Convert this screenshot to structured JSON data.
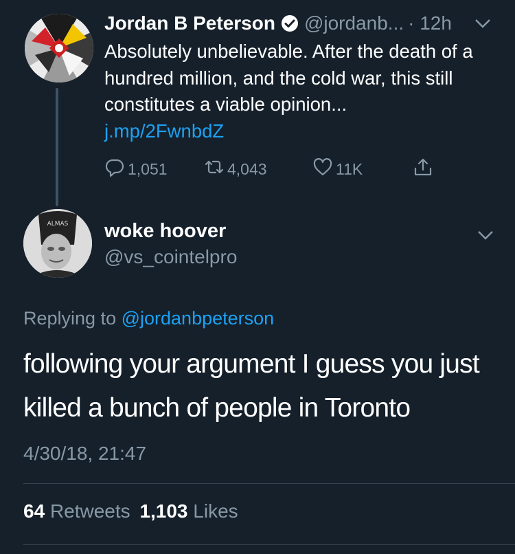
{
  "parent_tweet": {
    "display_name": "Jordan B Peterson",
    "handle": "@jordanb...",
    "time": "· 12h",
    "text": "Absolutely unbelievable. After the death of a hundred million, and the cold war, this still constitutes a viable opinion...",
    "link": "j.mp/2FwnbdZ",
    "reply_count": "1,051",
    "retweet_count": "4,043",
    "like_count": "11K",
    "icons": [
      "verified-icon",
      "chevron-down-icon",
      "reply-icon",
      "retweet-icon",
      "like-icon",
      "share-icon"
    ]
  },
  "reply_tweet": {
    "display_name": "woke hoover",
    "handle": "@vs_cointelpro",
    "replying_prefix": "Replying to",
    "replying_to": "@jordanbpeterson",
    "text": "following your argument I guess you just killed a bunch of people in Toronto",
    "timestamp": "4/30/18, 21:47",
    "retweets_count": "64",
    "retweets_label": "Retweets",
    "likes_count": "1,103",
    "likes_label": "Likes"
  },
  "colors": {
    "background": "#15202b",
    "text": "#ffffff",
    "secondary": "#8899a6",
    "link": "#1da1f2",
    "divider": "#38444d"
  }
}
